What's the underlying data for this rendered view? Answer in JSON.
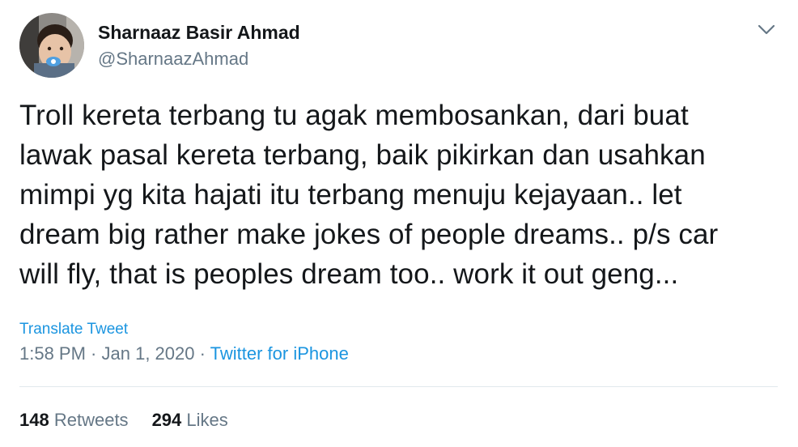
{
  "author": {
    "display_name": "Sharnaaz Basir Ahmad",
    "handle": "@SharnaazAhmad",
    "avatar_icon": "baby-with-pacifier-avatar"
  },
  "menu_icon": "chevron-down-icon",
  "tweet": {
    "lines": [
      "Troll kereta terbang tu agak membosankan, dari buat",
      "lawak pasal kereta terbang, baik pikirkan dan usahkan",
      "mimpi yg kita hajati itu terbang menuju kejayaan.. let",
      "dream big rather make jokes of people dreams.. p/s car",
      "will fly, that is peoples dream too.. work it out geng..."
    ],
    "translate_label": "Translate Tweet"
  },
  "meta": {
    "time": "1:58 PM",
    "separator": " · ",
    "date": "Jan 1, 2020",
    "source": "Twitter for iPhone"
  },
  "stats": {
    "retweets_count": "148",
    "retweets_label": "Retweets",
    "likes_count": "294",
    "likes_label": "Likes"
  },
  "colors": {
    "link": "#1b95e0",
    "secondary_text": "#657786",
    "primary_text": "#14171a",
    "divider": "#e1e8ed"
  }
}
